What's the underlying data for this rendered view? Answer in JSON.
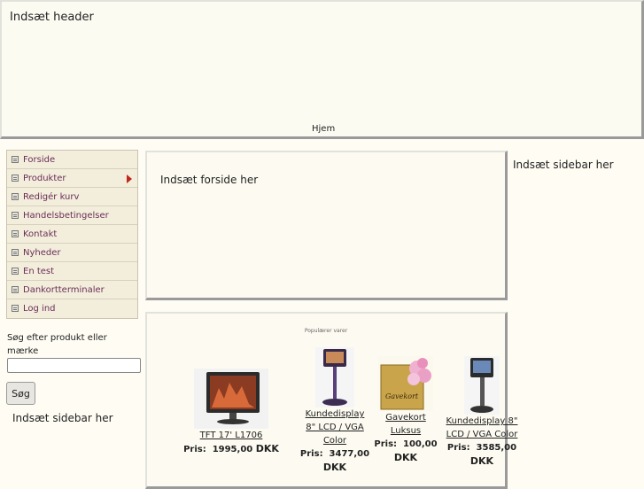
{
  "header": {
    "title": "Indsæt header",
    "nav_home": "Hjem"
  },
  "menu": {
    "items": [
      {
        "label": "Forside"
      },
      {
        "label": "Produkter"
      },
      {
        "label": "Redigér kurv"
      },
      {
        "label": "Handelsbetingelser"
      },
      {
        "label": "Kontakt"
      },
      {
        "label": "Nyheder"
      },
      {
        "label": "En test"
      },
      {
        "label": "Dankortterminaler"
      },
      {
        "label": "Log ind"
      }
    ]
  },
  "search": {
    "label": "Søg efter produkt eller mærke",
    "value": "",
    "button_label": "Søg"
  },
  "left_sidebar": {
    "text": "Indsæt sidebar her"
  },
  "frontpage": {
    "text": "Indsæt forside her"
  },
  "right_sidebar": {
    "text": "Indsæt sidebar her"
  },
  "popular": {
    "heading": "Populærer varer",
    "products": [
      {
        "name": "TFT 17' L1706",
        "price_prefix": "Pris:",
        "price": "1995,00",
        "currency": "DKK"
      },
      {
        "name": "Kundedisplay 8\" LCD / VGA Color",
        "price_prefix": "Pris:",
        "price": "3477,00",
        "currency": "DKK"
      },
      {
        "name": "Gavekort Luksus",
        "price_prefix": "Pris:",
        "price": "100,00",
        "currency": "DKK",
        "image_text": "Gavekort"
      },
      {
        "name": "Kundedisplay 8\" LCD / VGA Color",
        "price_prefix": "Pris:",
        "price": "3585,00",
        "currency": "DKK"
      }
    ]
  }
}
